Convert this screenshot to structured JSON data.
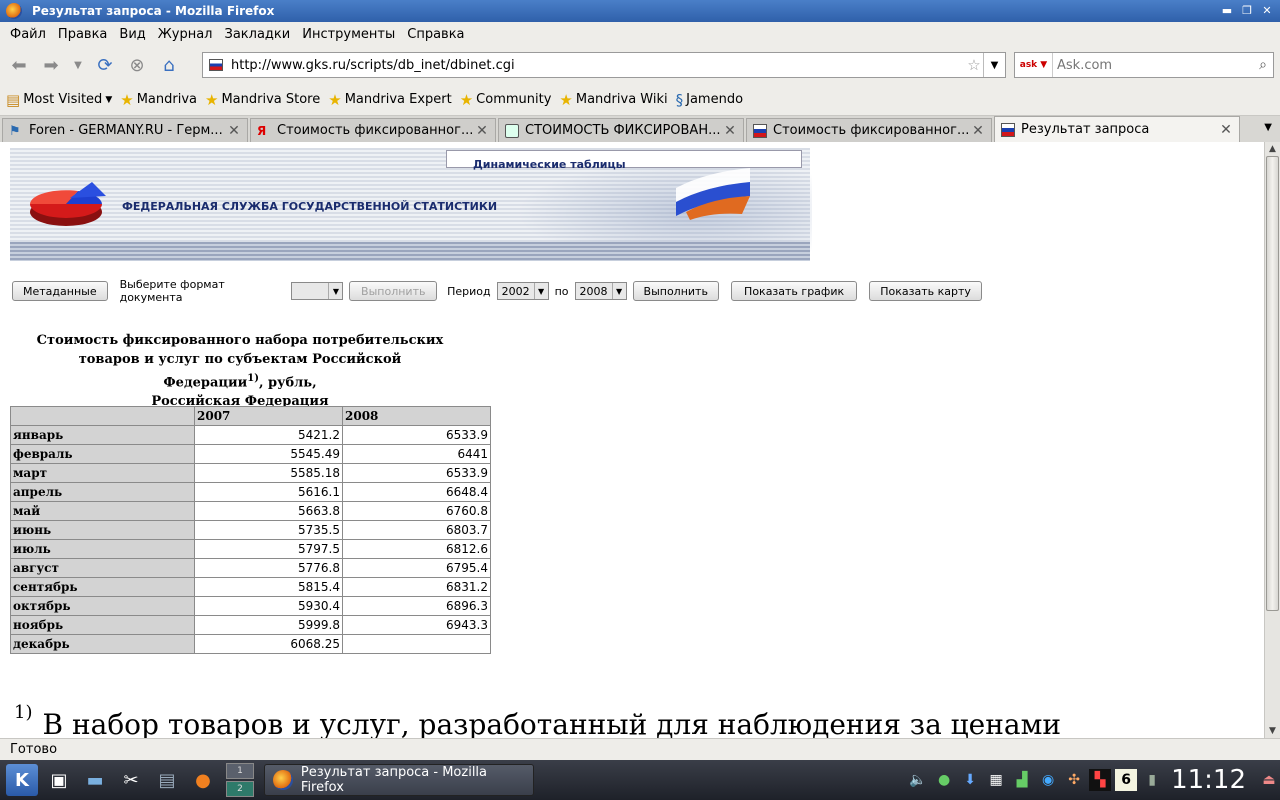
{
  "window": {
    "title": "Результат запроса - Mozilla Firefox"
  },
  "menu": [
    "Файл",
    "Правка",
    "Вид",
    "Журнал",
    "Закладки",
    "Инструменты",
    "Справка"
  ],
  "nav": {
    "url": "http://www.gks.ru/scripts/db_inet/dbinet.cgi",
    "search_placeholder": "Ask.com"
  },
  "bookmarks": [
    "Most Visited",
    "Mandriva",
    "Mandriva Store",
    "Mandriva Expert",
    "Community",
    "Mandriva Wiki",
    "Jamendo"
  ],
  "tabs": [
    {
      "label": "Foren - GERMANY.RU - Герм...",
      "active": false
    },
    {
      "label": "Стоимость фиксированног...",
      "active": false
    },
    {
      "label": "СТОИМОСТЬ ФИКСИРОВАН...",
      "active": false
    },
    {
      "label": "Стоимость фиксированног...",
      "active": false
    },
    {
      "label": "Результат запроса",
      "active": true
    }
  ],
  "banner": {
    "dynamic": "Динамические таблицы",
    "agency": "ФЕДЕРАЛЬНАЯ СЛУЖБА ГОСУДАРСТВЕННОЙ СТАТИСТИКИ"
  },
  "controls": {
    "metadata": "Метаданные",
    "format_label": "Выберите формат документа",
    "format_value": "",
    "run_disabled": "Выполнить",
    "period_label": "Период",
    "period_from": "2002",
    "to_label": "по",
    "period_to": "2008",
    "run": "Выполнить",
    "show_chart": "Показать график",
    "show_map": "Показать карту"
  },
  "report": {
    "title_line1": "Стоимость фиксированного набора потребительских",
    "title_line2": "товаров и услуг по субъектам Российской",
    "title_line3a": "Федерации",
    "title_sup": "1)",
    "title_line3b": ", рубль,",
    "title_line4": "Российская Федерация",
    "columns": [
      "2007",
      "2008"
    ],
    "rows": [
      {
        "month": "январь",
        "v2007": "5421.2",
        "v2008": "6533.9"
      },
      {
        "month": "февраль",
        "v2007": "5545.49",
        "v2008": "6441"
      },
      {
        "month": "март",
        "v2007": "5585.18",
        "v2008": "6533.9"
      },
      {
        "month": "апрель",
        "v2007": "5616.1",
        "v2008": "6648.4"
      },
      {
        "month": "май",
        "v2007": "5663.8",
        "v2008": "6760.8"
      },
      {
        "month": "июнь",
        "v2007": "5735.5",
        "v2008": "6803.7"
      },
      {
        "month": "июль",
        "v2007": "5797.5",
        "v2008": "6812.6"
      },
      {
        "month": "август",
        "v2007": "5776.8",
        "v2008": "6795.4"
      },
      {
        "month": "сентябрь",
        "v2007": "5815.4",
        "v2008": "6831.2"
      },
      {
        "month": "октябрь",
        "v2007": "5930.4",
        "v2008": "6896.3"
      },
      {
        "month": "ноябрь",
        "v2007": "5999.8",
        "v2008": "6943.3"
      },
      {
        "month": "декабрь",
        "v2007": "6068.25",
        "v2008": ""
      }
    ],
    "footnote_mark": "1)",
    "footnote_text": "В набор товаров и услуг, разработанный для наблюдения за ценами"
  },
  "status": "Готово",
  "taskbar": {
    "task": "Результат запроса - Mozilla Firefox",
    "clock": "11:12",
    "pager": [
      "1",
      "2"
    ],
    "tray_badge": "6"
  }
}
